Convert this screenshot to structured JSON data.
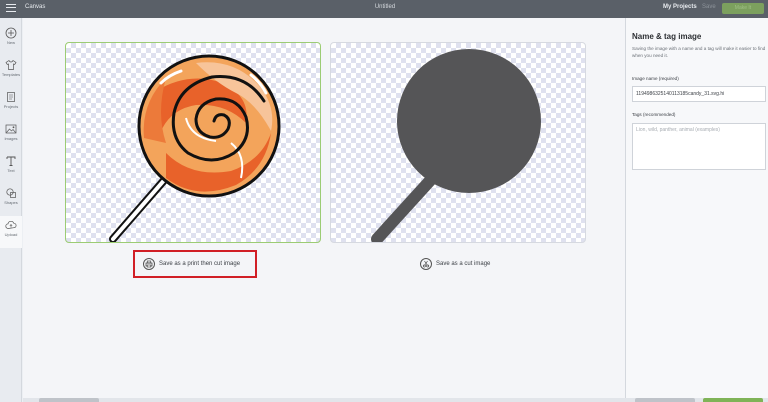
{
  "topbar": {
    "app_name": "Canvas",
    "document_title": "Untitled",
    "my_projects": "My Projects",
    "save": "Save",
    "make_it": "Make It"
  },
  "sidebar": {
    "items": [
      {
        "label": "New",
        "icon": "plus-circle-icon"
      },
      {
        "label": "Templates",
        "icon": "shirt-icon"
      },
      {
        "label": "Projects",
        "icon": "projects-icon"
      },
      {
        "label": "Images",
        "icon": "image-icon"
      },
      {
        "label": "Text",
        "icon": "text-icon"
      },
      {
        "label": "Shapes",
        "icon": "shapes-icon"
      },
      {
        "label": "Upload",
        "icon": "cloud-upload-icon"
      }
    ]
  },
  "main": {
    "print_option": "Save as a print then cut image",
    "cut_option": "Save as a cut image"
  },
  "right_panel": {
    "title": "Name & tag image",
    "description": "Saving the image with a name and a tag will make it easier to find when you need it.",
    "name_label": "Image name (required)",
    "name_value": "1194986325140113185candy_31.svg.hi",
    "tags_label": "Tags (recommended)",
    "tags_placeholder": "Lion, wild, panther, animal (examples)"
  },
  "colors": {
    "accent": "#7fb357",
    "highlight": "#d11f26",
    "topbar": "#5a6068"
  }
}
